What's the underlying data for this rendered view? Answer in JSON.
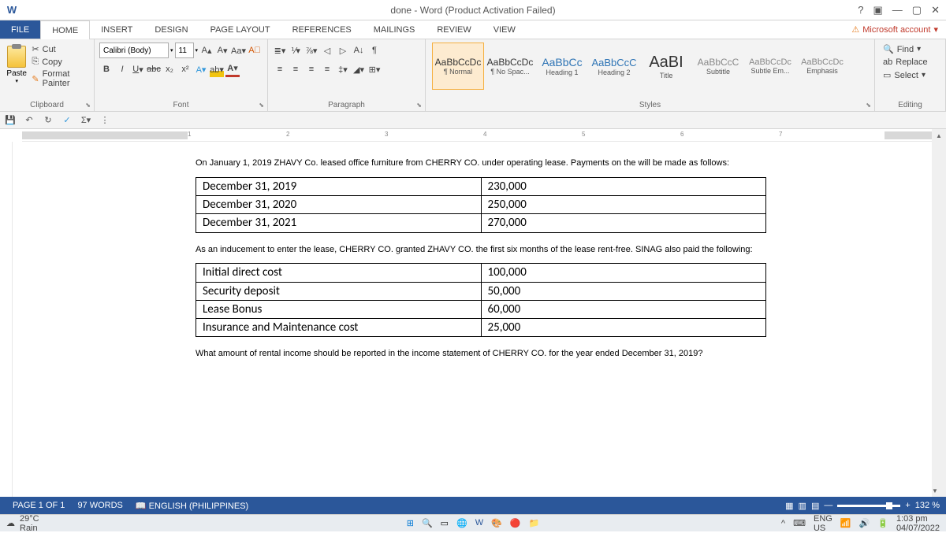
{
  "title": "done - Word (Product Activation Failed)",
  "tabs": {
    "file": "FILE",
    "home": "HOME",
    "insert": "INSERT",
    "design": "DESIGN",
    "page_layout": "PAGE LAYOUT",
    "references": "REFERENCES",
    "mailings": "MAILINGS",
    "review": "REVIEW",
    "view": "VIEW"
  },
  "ms_account": "Microsoft account",
  "clipboard": {
    "paste": "Paste",
    "cut": "Cut",
    "copy": "Copy",
    "fp": "Format Painter",
    "label": "Clipboard"
  },
  "font": {
    "name": "Calibri (Body)",
    "size": "11",
    "label": "Font"
  },
  "paragraph": {
    "label": "Paragraph"
  },
  "styles": {
    "label": "Styles",
    "items": [
      {
        "prev": "AaBbCcDc",
        "name": "¶ Normal"
      },
      {
        "prev": "AaBbCcDc",
        "name": "¶ No Spac..."
      },
      {
        "prev": "AaBbCc",
        "name": "Heading 1"
      },
      {
        "prev": "AaBbCcC",
        "name": "Heading 2"
      },
      {
        "prev": "AaBI",
        "name": "Title"
      },
      {
        "prev": "AaBbCcC",
        "name": "Subtitle"
      },
      {
        "prev": "AaBbCcDc",
        "name": "Subtle Em..."
      },
      {
        "prev": "AaBbCcDc",
        "name": "Emphasis"
      }
    ]
  },
  "editing": {
    "find": "Find",
    "replace": "Replace",
    "select": "Select",
    "label": "Editing"
  },
  "ruler_marks": [
    "1",
    "2",
    "3",
    "4",
    "5",
    "6",
    "7"
  ],
  "document": {
    "p1": "On January 1, 2019 ZHAVY Co. leased office furniture from CHERRY CO. under operating lease. Payments on the will be made as follows:",
    "table1": [
      [
        "December 31, 2019",
        "230,000"
      ],
      [
        "December 31, 2020",
        "250,000"
      ],
      [
        "December 31, 2021",
        "270,000"
      ]
    ],
    "p2": "As an inducement to enter the lease, CHERRY CO. granted ZHAVY CO. the first six months of the lease rent-free. SINAG also paid the following:",
    "table2": [
      [
        "Initial direct cost",
        "100,000"
      ],
      [
        "Security deposit",
        "50,000"
      ],
      [
        "Lease Bonus",
        "60,000"
      ],
      [
        "Insurance and Maintenance cost",
        "25,000"
      ]
    ],
    "p3": "What amount of rental income should be reported in the income statement of CHERRY CO. for the year ended December 31, 2019?"
  },
  "statusbar": {
    "page": "PAGE 1 OF 1",
    "words": "97 WORDS",
    "lang": "ENGLISH (PHILIPPINES)",
    "zoom": "132 %"
  },
  "taskbar": {
    "temp": "29°C",
    "weather": "Rain",
    "lang": "ENG",
    "region": "US",
    "time": "1:03 pm",
    "date": "04/07/2022"
  }
}
